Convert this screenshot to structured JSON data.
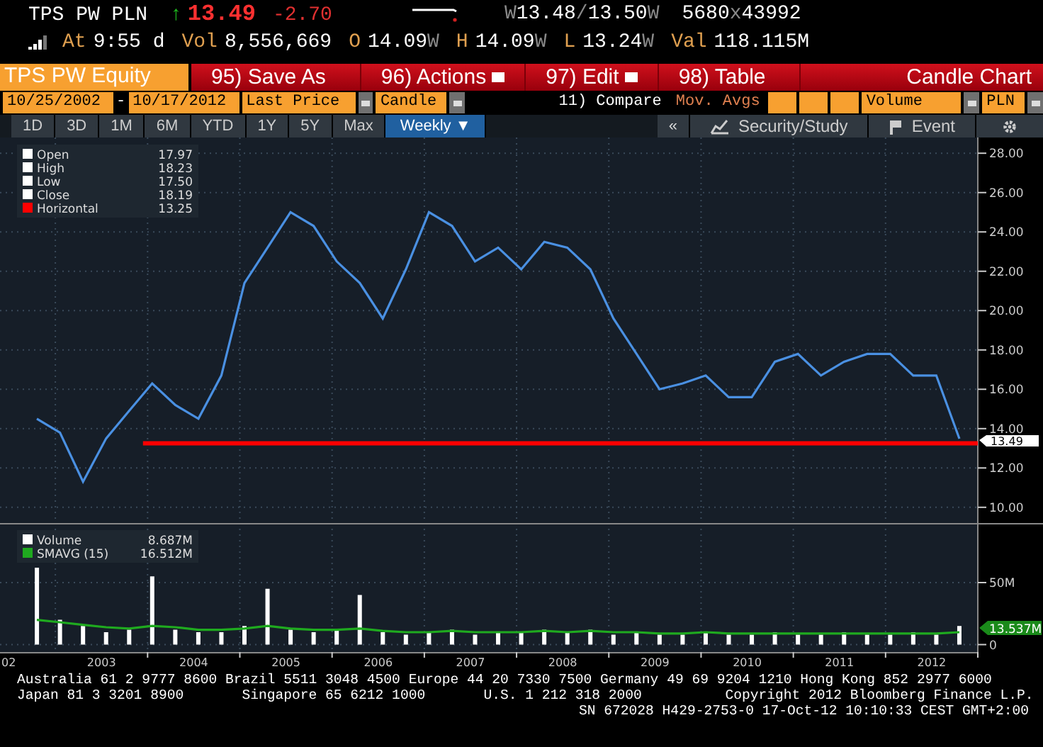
{
  "quote_line": [
    {
      "text": "TPS PW PLN",
      "kind": "value"
    },
    {
      "text": "↑",
      "kind": "up"
    },
    {
      "text": "13.49",
      "kind": "last"
    },
    {
      "text": "-2.70",
      "kind": "neg"
    }
  ],
  "bid_ask_line": [
    {
      "text": "W",
      "kind": "dim"
    },
    {
      "text": "13.48",
      "kind": "value"
    },
    {
      "text": "/",
      "kind": "dim"
    },
    {
      "text": "13.50",
      "kind": "value"
    },
    {
      "text": "W",
      "kind": "dim"
    }
  ],
  "size_line": [
    {
      "text": "5680",
      "kind": "value"
    },
    {
      "text": "x",
      "kind": "dim"
    },
    {
      "text": "43992",
      "kind": "value"
    }
  ],
  "stats_line": [
    {
      "text": "At",
      "kind": "label"
    },
    {
      "text": "9:55 d",
      "kind": "value"
    },
    {
      "text": "Vol",
      "kind": "label"
    },
    {
      "text": "8,556,669",
      "kind": "value"
    },
    {
      "text": "O",
      "kind": "label"
    },
    {
      "text": "14.09",
      "kind": "value"
    },
    {
      "text": "W",
      "kind": "dim"
    },
    {
      "text": "H",
      "kind": "label"
    },
    {
      "text": "14.09",
      "kind": "value"
    },
    {
      "text": "W",
      "kind": "dim"
    },
    {
      "text": "L",
      "kind": "label"
    },
    {
      "text": "13.24",
      "kind": "value"
    },
    {
      "text": "W",
      "kind": "dim"
    },
    {
      "text": "Val",
      "kind": "label"
    },
    {
      "text": "118.115M",
      "kind": "value"
    }
  ],
  "security_field": "TPS PW Equity",
  "menu_buttons": [
    {
      "number": "95)",
      "label": "Save As",
      "dropdown": false
    },
    {
      "number": "96)",
      "label": "Actions",
      "dropdown": true
    },
    {
      "number": "97)",
      "label": "Edit",
      "dropdown": true
    },
    {
      "number": "98)",
      "label": "Table",
      "dropdown": false
    }
  ],
  "chart_title": "Candle Chart",
  "settings": {
    "date_from": "10/25/2002",
    "date_separator": "-",
    "date_to": "10/17/2012",
    "price_field": "Last Price",
    "chart_type": "Candle",
    "compare": "11) Compare",
    "moving_averages": "Mov. Avgs",
    "study": "Volume",
    "currency": "PLN"
  },
  "periods": [
    {
      "label": "1D",
      "selected": false
    },
    {
      "label": "3D",
      "selected": false
    },
    {
      "label": "1M",
      "selected": false
    },
    {
      "label": "6M",
      "selected": false
    },
    {
      "label": "YTD",
      "selected": false
    },
    {
      "label": "1Y",
      "selected": false
    },
    {
      "label": "5Y",
      "selected": false
    },
    {
      "label": "Max",
      "selected": false
    },
    {
      "label": "Weekly ▼",
      "selected": true
    }
  ],
  "collapse_button": "«",
  "tool_buttons": [
    {
      "label": "Security/Study",
      "kind": "study"
    },
    {
      "label": "Event",
      "kind": "event"
    },
    {
      "kind": "settings"
    }
  ],
  "price_legend": [
    {
      "label": "Open",
      "value": "17.97",
      "color": "#ffffff"
    },
    {
      "label": "High",
      "value": "18.23",
      "color": "#ffffff"
    },
    {
      "label": "Low",
      "value": "17.50",
      "color": "#ffffff"
    },
    {
      "label": "Close",
      "value": "18.19",
      "color": "#ffffff"
    },
    {
      "label": "Horizontal",
      "value": "13.25",
      "color": "#ff0000"
    }
  ],
  "last_price_tag": "13.49",
  "price_chart": {
    "chart_data": {
      "type": "line",
      "ylim": [
        9.2,
        28.8
      ],
      "grid": true,
      "yticks": [
        {
          "value": 10,
          "label": "10.00"
        },
        {
          "value": 12,
          "label": "12.00"
        },
        {
          "value": 14,
          "label": "14.00"
        },
        {
          "value": 16,
          "label": "16.00"
        },
        {
          "value": 18,
          "label": "18.00"
        },
        {
          "value": 20,
          "label": "20.00"
        },
        {
          "value": 22,
          "label": "22.00"
        },
        {
          "value": 24,
          "label": "24.00"
        },
        {
          "value": 26,
          "label": "26.00"
        },
        {
          "value": 28,
          "label": "28.00"
        }
      ],
      "categories": [
        null,
        null,
        null,
        null,
        null,
        null,
        null,
        null,
        null,
        null,
        null,
        null,
        null,
        null,
        null,
        null,
        null,
        null,
        null,
        null,
        null,
        null,
        null,
        null,
        null,
        null,
        null,
        null,
        null,
        null,
        null,
        null,
        null,
        null,
        null,
        null,
        null,
        null,
        null,
        null,
        null
      ],
      "series": [
        {
          "color": "#4a90e2",
          "values": [
            14.5,
            13.8,
            11.3,
            13.5,
            14.9,
            16.3,
            15.2,
            14.5,
            16.7,
            21.4,
            23.2,
            25.0,
            24.3,
            22.5,
            21.4,
            19.6,
            22.1,
            25.0,
            24.3,
            22.5,
            23.2,
            22.1,
            23.5,
            23.2,
            22.1,
            19.6,
            17.8,
            16.0,
            16.3,
            16.7,
            15.6,
            15.6,
            17.4,
            17.8,
            16.7,
            17.4,
            17.8,
            17.8,
            16.7,
            16.7,
            13.49
          ]
        }
      ],
      "ref_lines": [
        {
          "axis": "y",
          "value": 13.25,
          "color": "#ff0000"
        }
      ]
    }
  },
  "volume_legend": [
    {
      "value": "8.687M"
    },
    {
      "value": "16.512M"
    }
  ],
  "volume_tag": "13.537M",
  "cut_year_label": "02",
  "volume_chart": {
    "chart_data": {
      "type": "bar",
      "xlim": [
        2002.4,
        2013.0
      ],
      "ylim": [
        -6,
        98
      ],
      "grid": true,
      "yticks": [
        {
          "value": 0,
          "label": "0"
        },
        {
          "value": 50,
          "label": "50M"
        }
      ],
      "legend": true,
      "xticks": [
        {
          "value": 2003.5,
          "label": "2003"
        },
        {
          "value": 2004.5,
          "label": "2004"
        },
        {
          "value": 2005.5,
          "label": "2005"
        },
        {
          "value": 2006.5,
          "label": "2006"
        },
        {
          "value": 2007.5,
          "label": "2007"
        },
        {
          "value": 2008.5,
          "label": "2008"
        },
        {
          "value": 2009.5,
          "label": "2009"
        },
        {
          "value": 2010.5,
          "label": "2010"
        },
        {
          "value": 2011.5,
          "label": "2011"
        },
        {
          "value": 2012.5,
          "label": "2012"
        }
      ],
      "x": [
        2002.8,
        2003.05,
        2003.3,
        2003.55,
        2003.8,
        2004.05,
        2004.3,
        2004.55,
        2004.8,
        2005.05,
        2005.3,
        2005.55,
        2005.8,
        2006.05,
        2006.3,
        2006.55,
        2006.8,
        2007.05,
        2007.3,
        2007.55,
        2007.8,
        2008.05,
        2008.3,
        2008.55,
        2008.8,
        2009.05,
        2009.3,
        2009.55,
        2009.8,
        2010.05,
        2010.3,
        2010.55,
        2010.8,
        2011.05,
        2011.3,
        2011.55,
        2011.8,
        2012.05,
        2012.3,
        2012.55,
        2012.8
      ],
      "series": [
        {
          "name": "Volume",
          "color": "#ffffff",
          "values": [
            62,
            20,
            15,
            10,
            12,
            55,
            12,
            10,
            10,
            15,
            45,
            12,
            10,
            12,
            40,
            10,
            8,
            10,
            12,
            8,
            10,
            10,
            12,
            10,
            12,
            8,
            10,
            8,
            8,
            10,
            8,
            8,
            10,
            8,
            8,
            10,
            8,
            8,
            10,
            8,
            15
          ]
        },
        {
          "name": "SMAVG (15)",
          "type": "line",
          "color": "#1faa1f",
          "values": [
            20,
            18,
            16,
            14,
            13,
            15,
            14,
            12,
            12,
            13,
            15,
            13,
            12,
            12,
            13,
            11,
            10,
            10,
            11,
            10,
            10,
            10,
            11,
            10,
            11,
            10,
            10,
            9,
            9,
            10,
            9,
            9,
            9,
            9,
            9,
            9,
            9,
            9,
            9,
            9,
            10
          ]
        }
      ]
    }
  },
  "footer": [
    "Australia 61 2 9777 8600 Brazil 5511 3048 4500 Europe 44 20 7330 7500 Germany 49 69 9204 1210 Hong Kong 852 2977 6000",
    "Japan 81 3 3201 8900       Singapore 65 6212 1000       U.S. 1 212 318 2000          Copyright 2012 Bloomberg Finance L.P.",
    "SN 672028 H429-2753-0 17-Oct-12 10:10:33 CEST GMT+2:00"
  ]
}
